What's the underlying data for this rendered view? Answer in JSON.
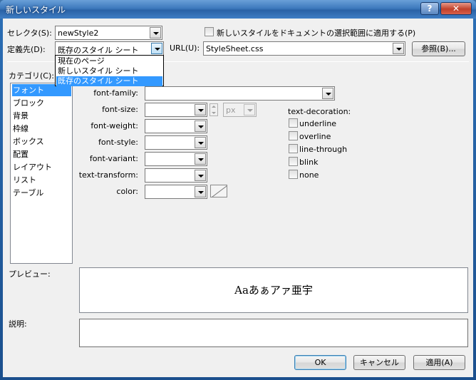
{
  "window": {
    "title": "新しいスタイル"
  },
  "selector": {
    "label": "セレクタ(S):",
    "value": "newStyle2"
  },
  "apply_to_selection": {
    "label": "新しいスタイルをドキュメントの選択範囲に適用する(P)",
    "checked": false
  },
  "define_in": {
    "label": "定義先(D):",
    "value": "既存のスタイル シート",
    "options": [
      "現在のページ",
      "新しいスタイル シート",
      "既存のスタイル シート"
    ],
    "selected_index": 2
  },
  "url": {
    "label": "URL(U):",
    "value": "StyleSheet.css",
    "browse_label": "参照(B)..."
  },
  "category": {
    "label": "カテゴリ(C):",
    "items": [
      "フォント",
      "ブロック",
      "背景",
      "枠線",
      "ボックス",
      "配置",
      "レイアウト",
      "リスト",
      "テーブル"
    ],
    "selected_index": 0
  },
  "font_props": {
    "font_family": "font-family:",
    "font_size": "font-size:",
    "font_size_unit": "px",
    "font_weight": "font-weight:",
    "font_style": "font-style:",
    "font_variant": "font-variant:",
    "text_transform": "text-transform:",
    "color": "color:"
  },
  "text_decoration": {
    "label": "text-decoration:",
    "options": [
      "underline",
      "overline",
      "line-through",
      "blink",
      "none"
    ]
  },
  "preview": {
    "label": "プレビュー:",
    "text": "Aaあぁアァ亜宇"
  },
  "description": {
    "label": "説明:",
    "text": ""
  },
  "buttons": {
    "ok": "OK",
    "cancel": "キャンセル",
    "apply": "適用(A)"
  }
}
